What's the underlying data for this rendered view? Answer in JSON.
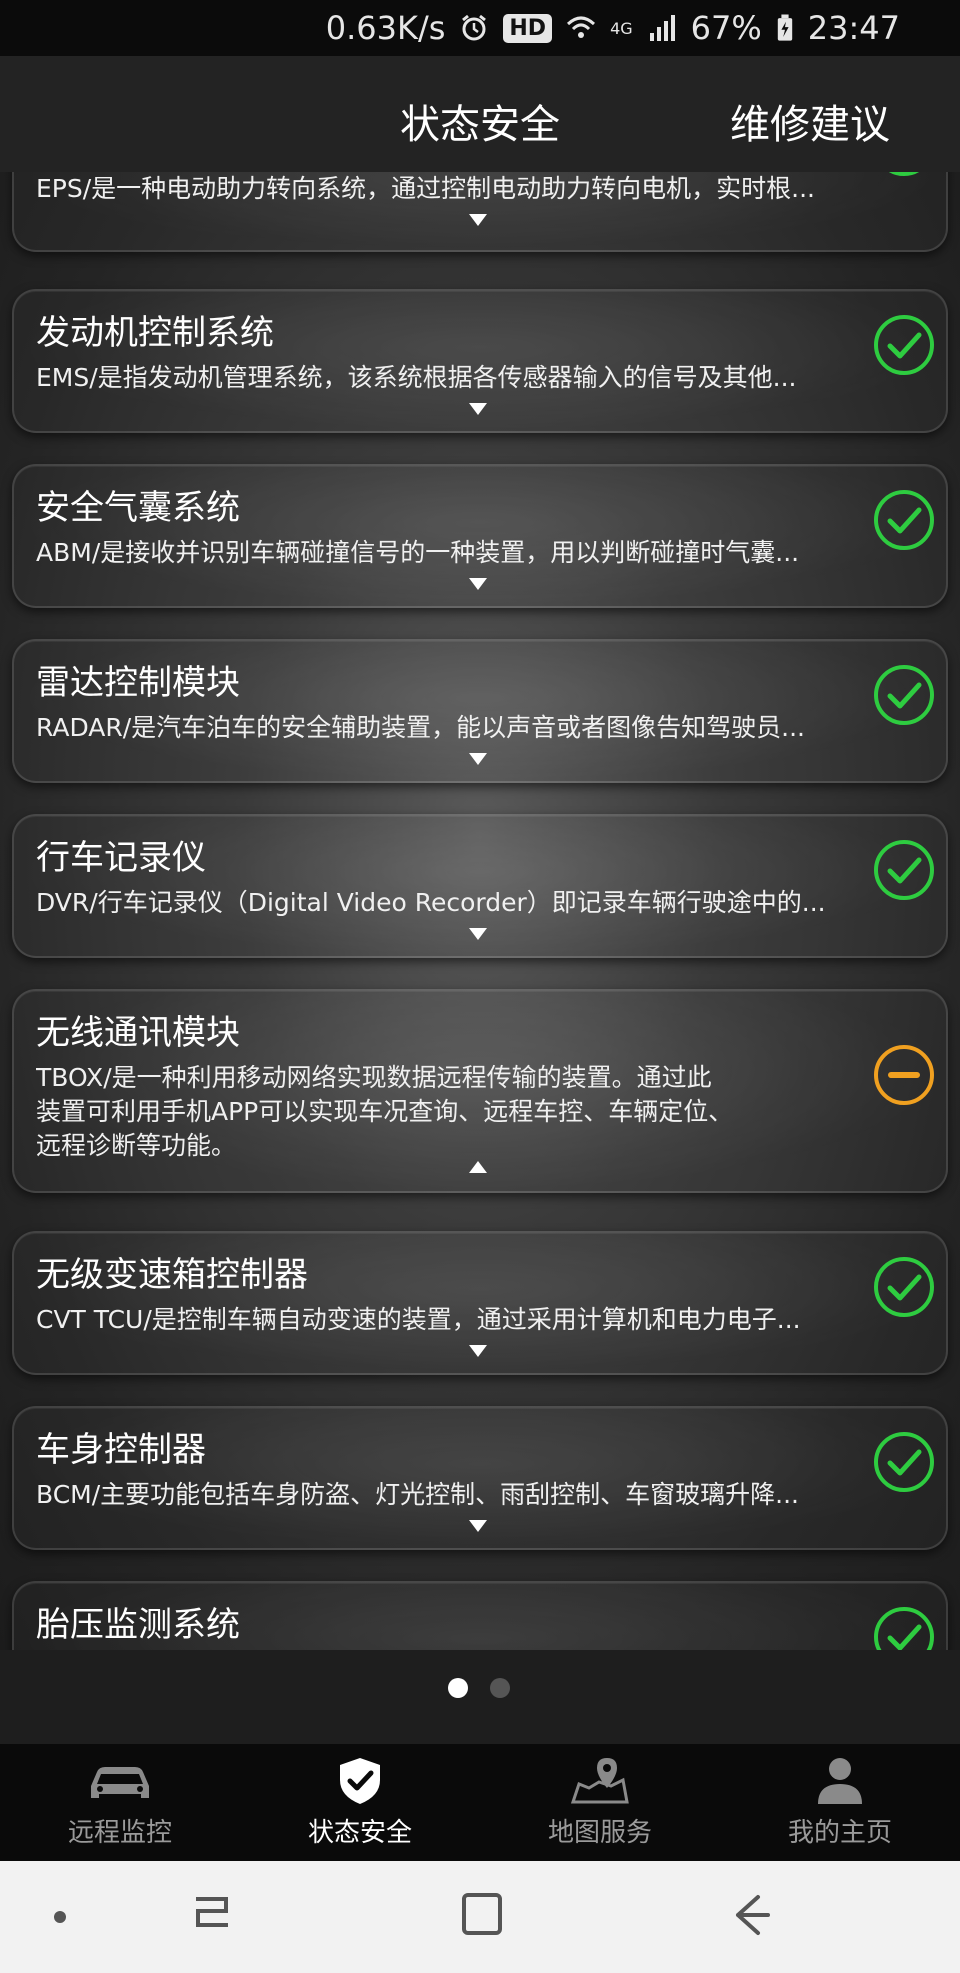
{
  "status_bar": {
    "speed": "0.63K/s",
    "hd": "HD",
    "network": "4G",
    "battery": "67%",
    "time": "23:47",
    "icons": [
      "alarm-icon",
      "wifi-icon",
      "signal-icon",
      "battery-icon"
    ]
  },
  "header": {
    "tabs": [
      {
        "label": "状态安全",
        "active": true
      },
      {
        "label": "维修建议",
        "active": false
      }
    ]
  },
  "cards": [
    {
      "title": "",
      "desc": "EPS/是一种电动助力转向系统，通过控制电动助力转向电机，实时根...",
      "expanded": false,
      "status": "ok"
    },
    {
      "title": "发动机控制系统",
      "desc": "EMS/是指发动机管理系统，该系统根据各传感器输入的信号及其他...",
      "expanded": false,
      "status": "ok"
    },
    {
      "title": "安全气囊系统",
      "desc": "ABM/是接收并识别车辆碰撞信号的一种装置，用以判断碰撞时气囊...",
      "expanded": false,
      "status": "ok"
    },
    {
      "title": "雷达控制模块",
      "desc": "RADAR/是汽车泊车的安全辅助装置，能以声音或者图像告知驾驶员...",
      "expanded": false,
      "status": "ok"
    },
    {
      "title": "行车记录仪",
      "desc": "DVR/行车记录仪（Digital Video Recorder）即记录车辆行驶途中的...",
      "expanded": false,
      "status": "ok"
    },
    {
      "title": "无线通讯模块",
      "desc": "TBOX/是一种利用移动网络实现数据远程传输的装置。通过此装置可利用手机APP可以实现车况查询、远程车控、车辆定位、远程诊断等功能。",
      "expanded": true,
      "status": "warning"
    },
    {
      "title": "无级变速箱控制器",
      "desc": "CVT TCU/是控制车辆自动变速的装置，通过采用计算机和电力电子...",
      "expanded": false,
      "status": "ok"
    },
    {
      "title": "车身控制器",
      "desc": "BCM/主要功能包括车身防盗、灯光控制、雨刮控制、车窗玻璃升降...",
      "expanded": false,
      "status": "ok"
    },
    {
      "title": "胎压监测系统",
      "desc": "",
      "expanded": false,
      "status": "ok"
    }
  ],
  "pager": {
    "count": 2,
    "active_index": 0
  },
  "bottom_nav": [
    {
      "label": "远程监控",
      "icon": "car-icon",
      "active": false
    },
    {
      "label": "状态安全",
      "icon": "shield-check-icon",
      "active": true
    },
    {
      "label": "地图服务",
      "icon": "map-pin-icon",
      "active": false
    },
    {
      "label": "我的主页",
      "icon": "person-icon",
      "active": false
    }
  ],
  "system_nav": [
    "dot-icon",
    "recent-apps-icon",
    "home-icon",
    "back-icon"
  ],
  "colors": {
    "ok": "#2ecc40",
    "warning": "#f0a020",
    "background": "#1e1e1e"
  }
}
